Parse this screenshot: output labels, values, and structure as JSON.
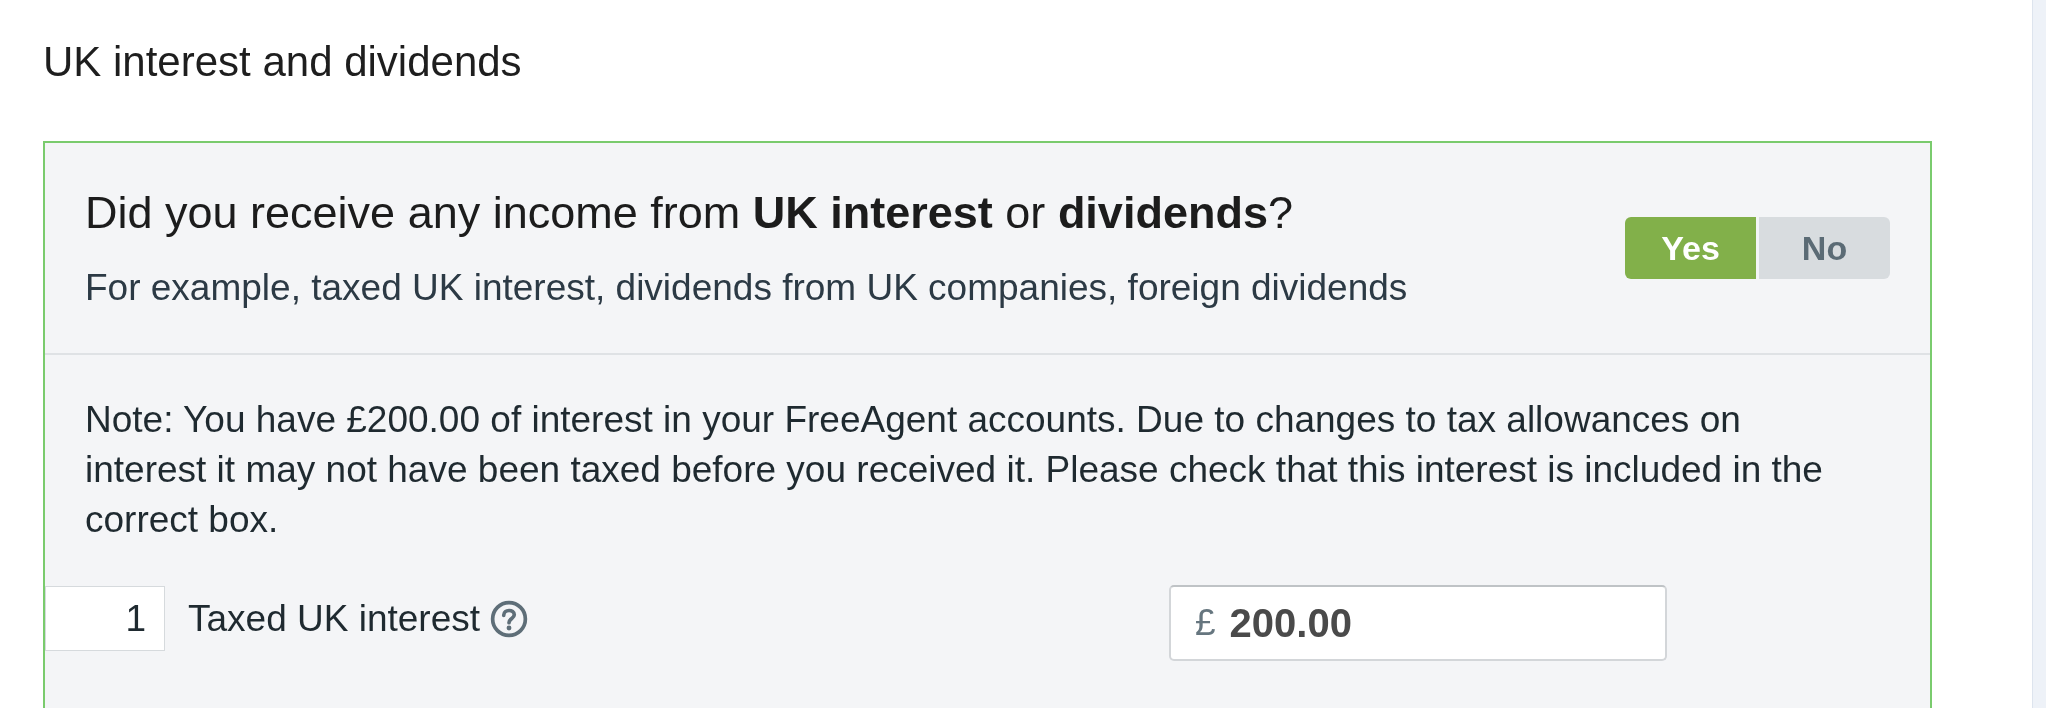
{
  "section_title": "UK interest and dividends",
  "question": {
    "text": "Did you receive any income from **UK interest** or **dividends**?",
    "hint": "For example, taxed UK interest, dividends from UK companies, foreign dividends",
    "options": [
      {
        "label": "Yes",
        "selected": true
      },
      {
        "label": "No",
        "selected": false
      }
    ]
  },
  "note": "Note: You have £200.00 of interest in your FreeAgent accounts. Due to changes to tax allowances on interest it may not have been taxed before you received it. Please check that this interest is included in the correct box.",
  "fields": [
    {
      "box_number": "1",
      "label": "Taxed UK interest",
      "currency": "£",
      "value": "200.00"
    }
  ]
}
